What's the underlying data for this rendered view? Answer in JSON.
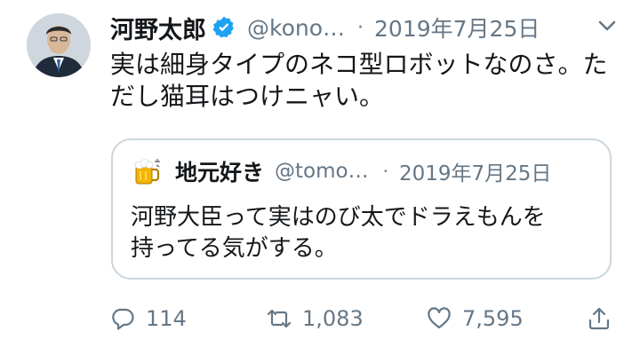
{
  "tweet": {
    "name": "河野太郎",
    "handle": "@kono…",
    "date": "2019年7月25日",
    "text": "実は細身タイプのネコ型ロボットなのさ。た\nだし猫耳はつけニャい。"
  },
  "quote": {
    "name": "地元好き",
    "handle": "@tomo…",
    "date": "2019年7月25日",
    "text": "河野大臣って実はのび太でドラえもんを\n持ってる気がする。"
  },
  "actions": {
    "replies": "114",
    "retweets": "1,083",
    "likes": "7,595"
  },
  "colors": {
    "text": "#14171a",
    "secondary": "#657786",
    "verified": "#1da1f2",
    "border": "#ccd6dd"
  }
}
